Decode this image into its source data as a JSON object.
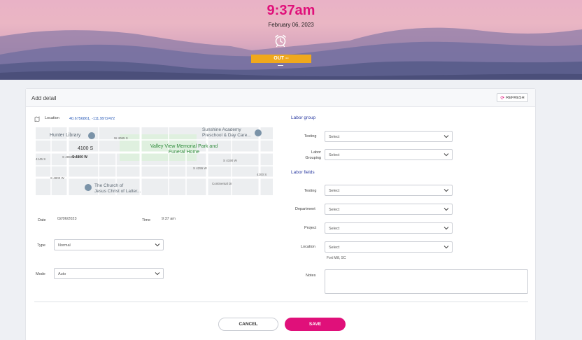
{
  "header": {
    "time": "9:37am",
    "date": "February 06, 2023",
    "status": "OUT  --",
    "status_color": "#F0A81C",
    "alarm_icon": "alarm-clock-icon"
  },
  "card": {
    "title": "Add detail",
    "refresh_label": "REFRESH",
    "location_label": "Location",
    "location_coords": "40.6756861, -111.9972472",
    "map": {
      "labels": [
        "Hunter Library",
        "W 4065 S",
        "Sunshine Academy Preschool & Day Care...",
        "4100 S",
        "Valley View Memorial Park and Funeral Home",
        "4145 S",
        "S 4850 W",
        "S 4800 W",
        "Jesus Christ of Latter...",
        "The Church of",
        "Continental Dr",
        "4200 S",
        "S 4800 W",
        "S 4255 W",
        "S 4190 W"
      ]
    },
    "date_label": "Date",
    "date_value": "02/06/2023",
    "time_label": "Time",
    "time_value": "9:37 am",
    "type_label": "Type",
    "type_value": "Normal",
    "mode_label": "Mode",
    "mode_value": "Auto",
    "labor_group_title": "Labor group",
    "labor_group": [
      {
        "label": "Testing",
        "value": "Select"
      },
      {
        "label": "Labor Grouping",
        "value": "Select"
      }
    ],
    "labor_fields_title": "Labor fields",
    "labor_fields": [
      {
        "label": "Testing",
        "value": "Select"
      },
      {
        "label": "Department",
        "value": "Select"
      },
      {
        "label": "Project",
        "value": "Select"
      },
      {
        "label": "Location",
        "value": "Select"
      }
    ],
    "location_note": "Fort Mill, SC",
    "notes_label": "Notes",
    "notes_value": "",
    "cancel_label": "CANCEL",
    "save_label": "SAVE",
    "accent_color": "#E0107A"
  }
}
